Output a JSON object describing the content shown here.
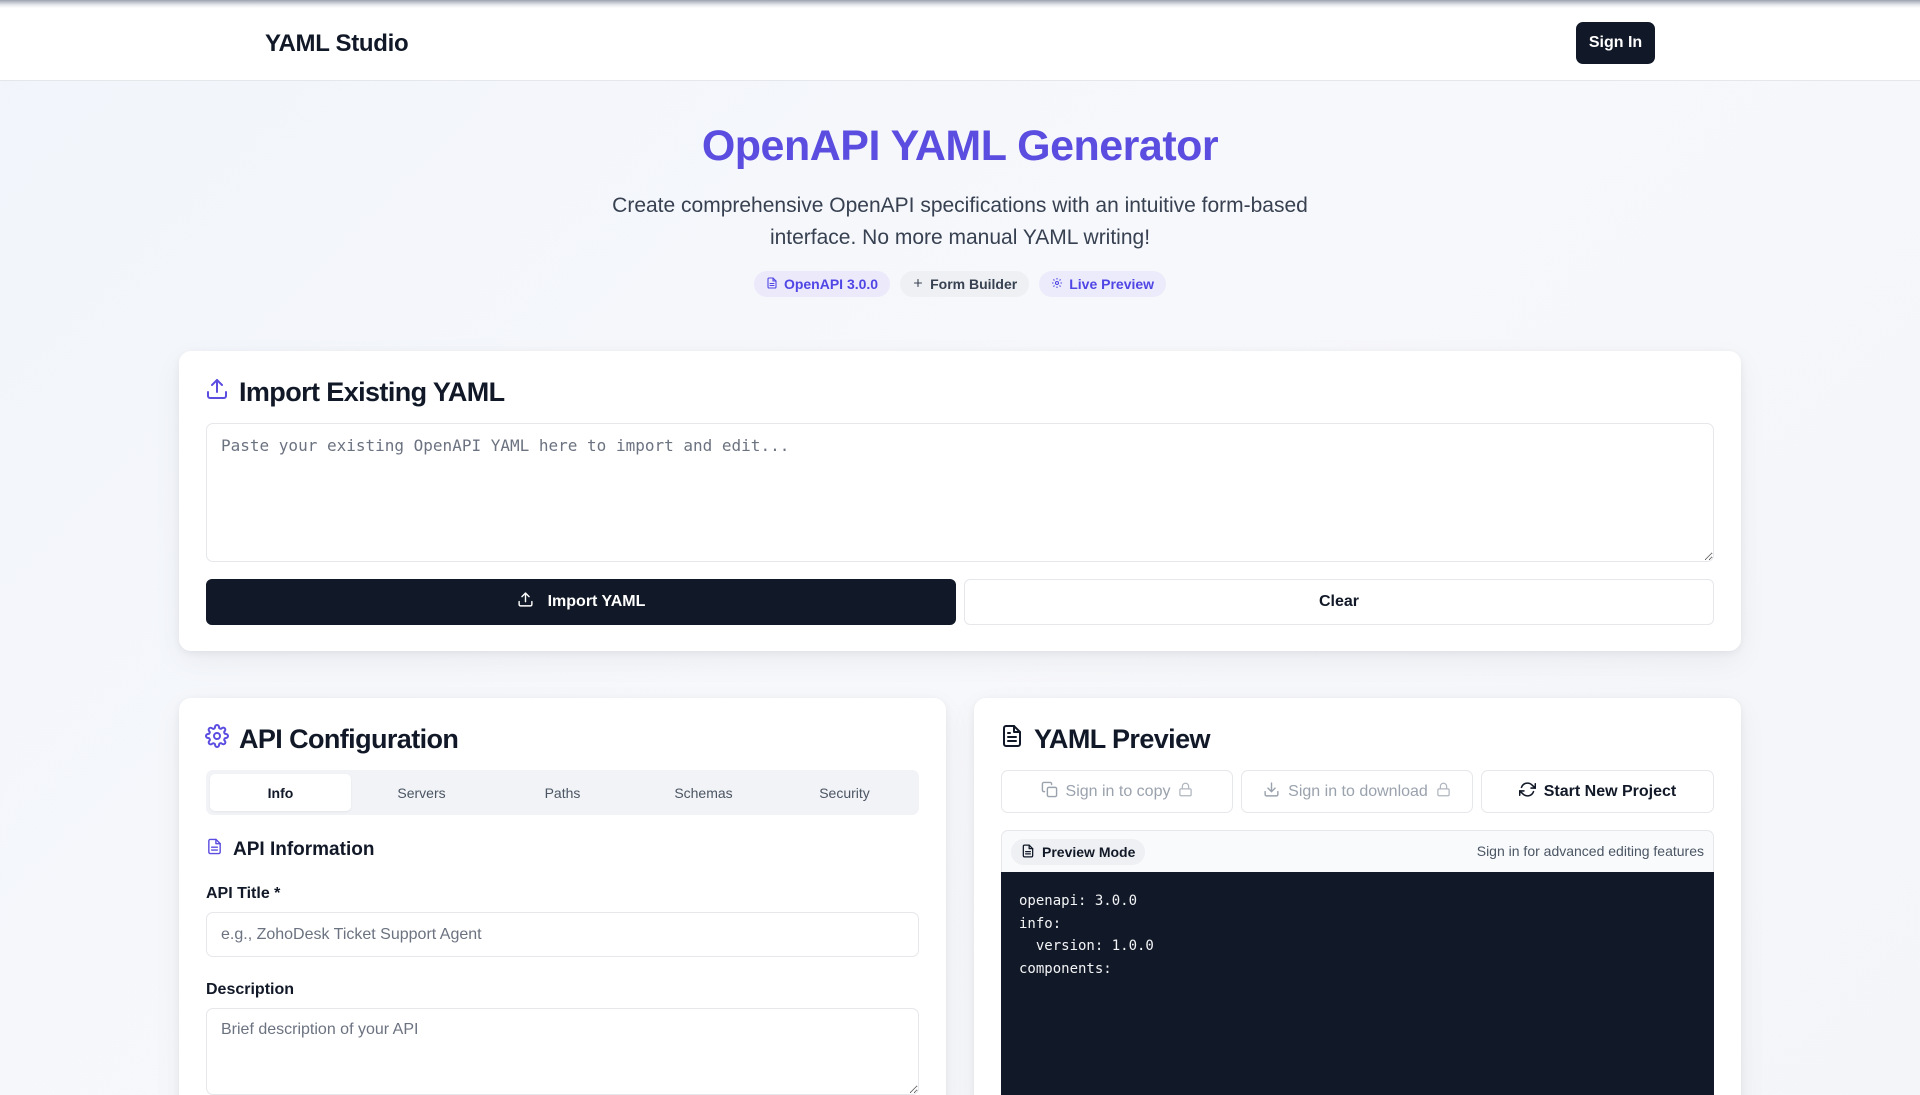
{
  "navbar": {
    "brand": "YAML Studio",
    "sign_in_label": "Sign In"
  },
  "hero": {
    "title": "OpenAPI YAML Generator",
    "subtitle_line1": "Create comprehensive OpenAPI specifications with an intuitive form-based",
    "subtitle_line2": "interface. No more manual YAML writing!",
    "badges": [
      {
        "label": "OpenAPI 3.0.0",
        "icon": "document-icon"
      },
      {
        "label": "Form Builder",
        "icon": "plus-icon"
      },
      {
        "label": "Live Preview",
        "icon": "gear-icon"
      }
    ]
  },
  "import_card": {
    "title": "Import Existing YAML",
    "textarea_placeholder": "Paste your existing OpenAPI YAML here to import and edit...",
    "import_button_label": "Import YAML",
    "clear_button_label": "Clear"
  },
  "config_card": {
    "title": "API Configuration",
    "tabs": [
      {
        "label": "Info",
        "active": true
      },
      {
        "label": "Servers",
        "active": false
      },
      {
        "label": "Paths",
        "active": false
      },
      {
        "label": "Schemas",
        "active": false
      },
      {
        "label": "Security",
        "active": false
      }
    ],
    "section_title": "API Information",
    "title_field": {
      "label": "API Title *",
      "placeholder": "e.g., ZohoDesk Ticket Support Agent",
      "value": ""
    },
    "description_field": {
      "label": "Description",
      "placeholder": "Brief description of your API",
      "value": ""
    }
  },
  "preview_card": {
    "title": "YAML Preview",
    "copy_label": "Sign in to copy",
    "download_label": "Sign in to download",
    "start_label": "Start New Project",
    "mode_label": "Preview Mode",
    "hint": "Sign in for advanced editing features",
    "yaml": "openapi: 3.0.0\ninfo:\n  version: 1.0.0\ncomponents:"
  },
  "colors": {
    "accent": "#5b4de0",
    "dark": "#111827",
    "muted": "#6b7280",
    "border": "#e5e7eb"
  }
}
